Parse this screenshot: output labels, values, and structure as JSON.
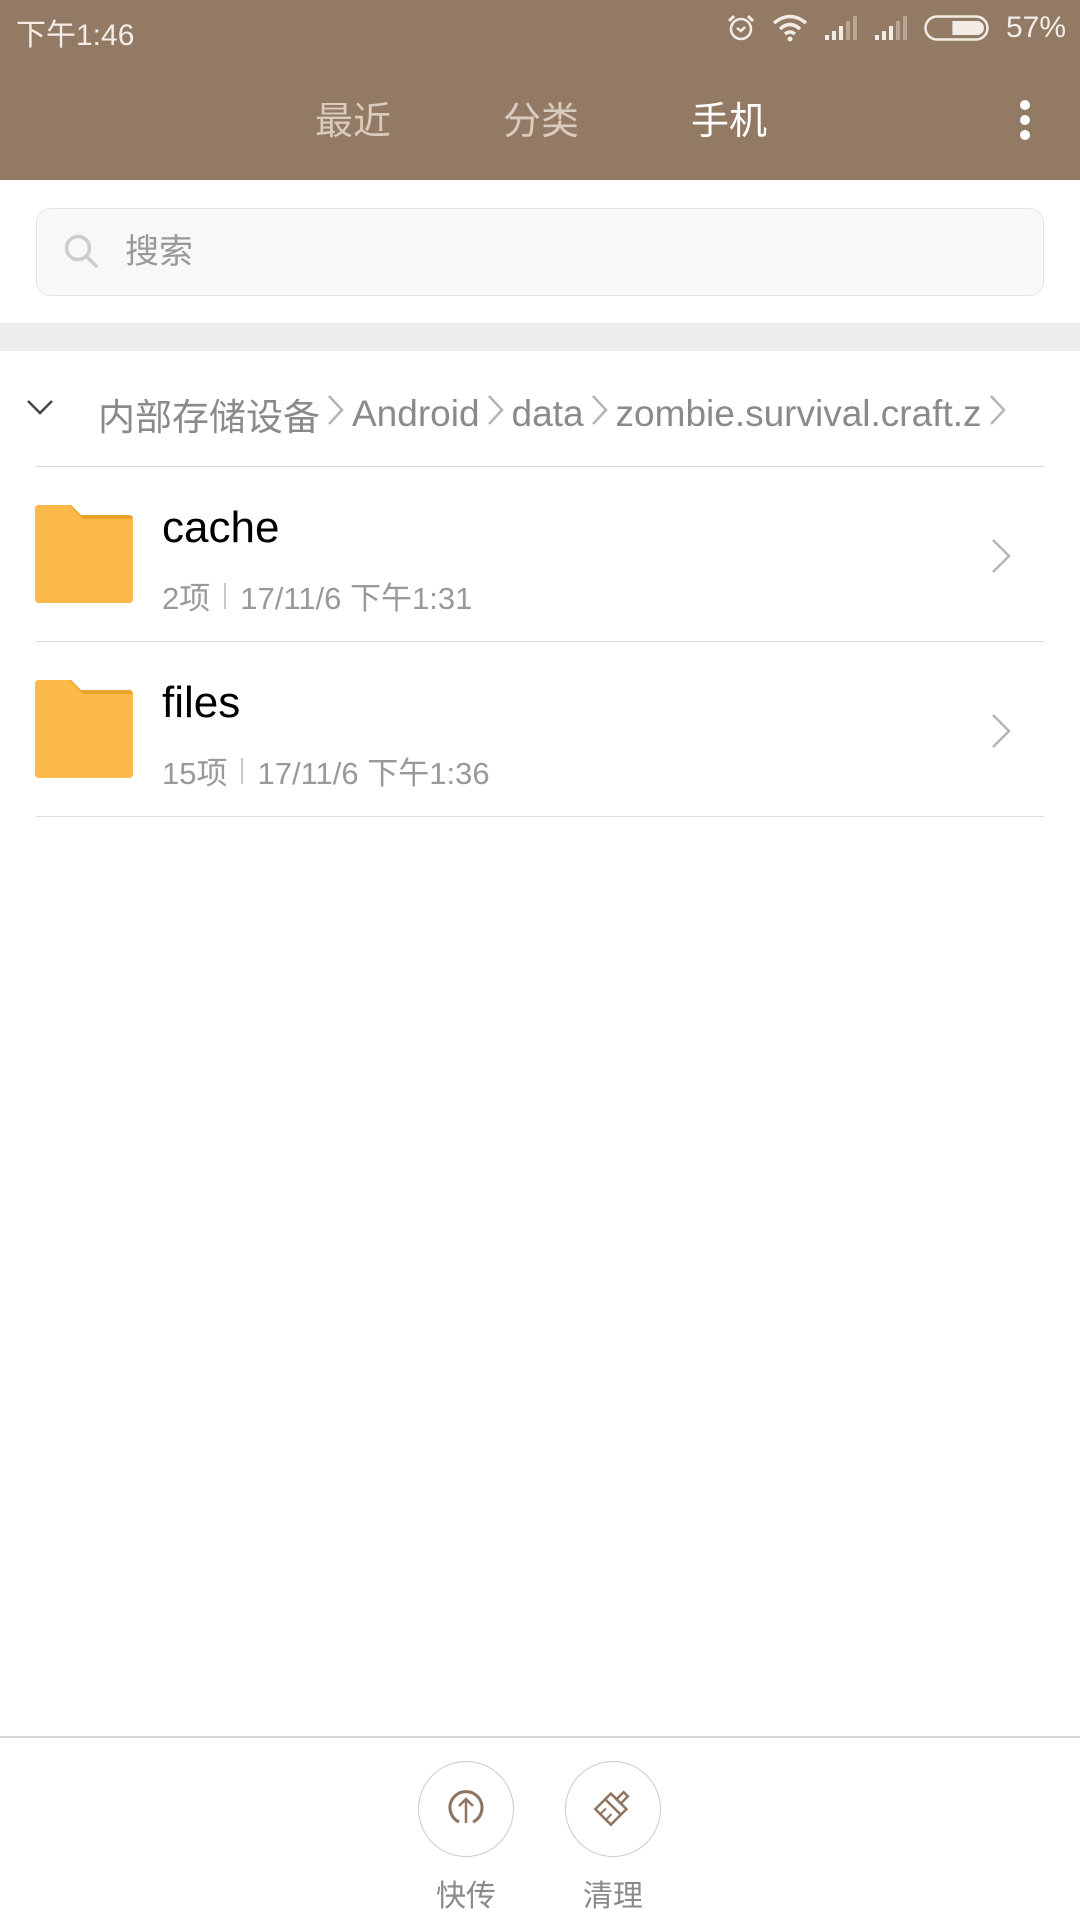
{
  "status_bar": {
    "time": "下午1:46",
    "icons": [
      "alarm-icon",
      "wifi-icon",
      "signal-icon",
      "signal-icon",
      "battery-icon"
    ],
    "battery_level_percent": 57,
    "battery_text": "57%"
  },
  "header": {
    "tabs": [
      {
        "label": "最近",
        "active": false
      },
      {
        "label": "分类",
        "active": false
      },
      {
        "label": "手机",
        "active": true
      }
    ],
    "more_icon": "more-vertical-icon"
  },
  "search": {
    "placeholder": "搜索",
    "value": ""
  },
  "breadcrumb": {
    "toggle_icon": "chevron-down-icon",
    "items": [
      "内部存储设备",
      "Android",
      "data",
      "zombie.survival.craft.z"
    ],
    "separator_icon": "chevron-right-icon"
  },
  "files": [
    {
      "name": "cache",
      "count": "2项",
      "modified": "17/11/6 下午1:31",
      "icon": "folder-icon"
    },
    {
      "name": "files",
      "count": "15项",
      "modified": "17/11/6 下午1:36",
      "icon": "folder-icon"
    }
  ],
  "actions": [
    {
      "label": "快传",
      "icon": "upload-icon"
    },
    {
      "label": "清理",
      "icon": "broom-icon"
    }
  ],
  "colors": {
    "header_bg": "#937A64",
    "folder": "#FBB949",
    "folder_tab": "#EBA12A",
    "accent_icon": "#8E7461"
  }
}
